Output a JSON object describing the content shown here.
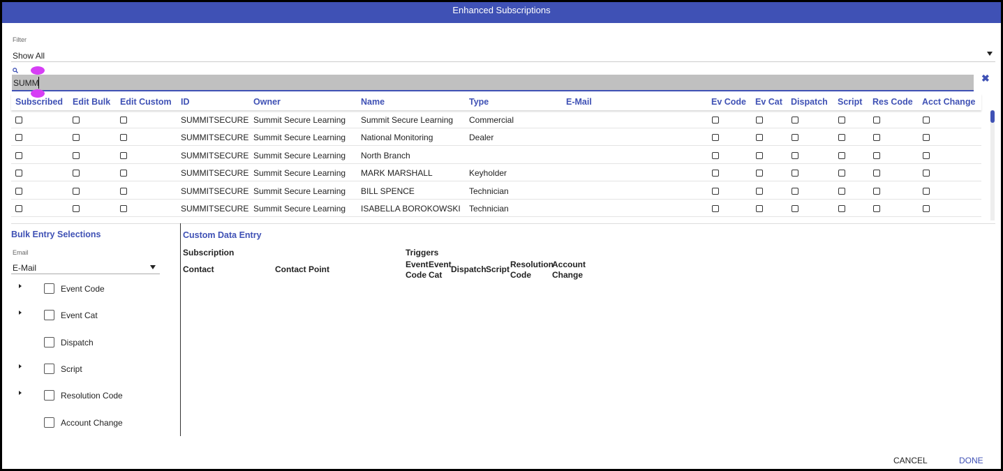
{
  "title": "Enhanced Subscriptions",
  "filter": {
    "label": "Filter",
    "value": "Show All"
  },
  "search": {
    "value": "SUMM"
  },
  "table": {
    "columns": [
      "Subscribed",
      "Edit Bulk",
      "Edit Custom",
      "ID",
      "Owner",
      "Name",
      "Type",
      "E-Mail",
      "Ev Code",
      "Ev Cat",
      "Dispatch",
      "Script",
      "Res Code",
      "Acct Change"
    ],
    "rows": [
      {
        "id": "SUMMITSECURE",
        "owner": "Summit Secure Learning",
        "name": "Summit Secure Learning",
        "type": "Commercial",
        "email": ""
      },
      {
        "id": "SUMMITSECURE",
        "owner": "Summit Secure Learning",
        "name": "National Monitoring",
        "type": "Dealer",
        "email": ""
      },
      {
        "id": "SUMMITSECURE",
        "owner": "Summit Secure Learning",
        "name": "North Branch",
        "type": "",
        "email": ""
      },
      {
        "id": "SUMMITSECURE",
        "owner": "Summit Secure Learning",
        "name": "MARK MARSHALL",
        "type": "Keyholder",
        "email": ""
      },
      {
        "id": "SUMMITSECURE",
        "owner": "Summit Secure Learning",
        "name": "BILL SPENCE",
        "type": "Technician",
        "email": ""
      },
      {
        "id": "SUMMITSECURE",
        "owner": "Summit Secure Learning",
        "name": "ISABELLA BOROKOWSKI",
        "type": "Technician",
        "email": ""
      }
    ]
  },
  "bulk": {
    "title": "Bulk Entry Selections",
    "email_label": "Email",
    "email_value": "E-Mail",
    "items": [
      {
        "label": "Event Code",
        "expandable": true
      },
      {
        "label": "Event Cat",
        "expandable": true
      },
      {
        "label": "Dispatch",
        "expandable": false
      },
      {
        "label": "Script",
        "expandable": true
      },
      {
        "label": "Resolution Code",
        "expandable": true
      },
      {
        "label": "Account Change",
        "expandable": false
      }
    ]
  },
  "custom": {
    "title": "Custom Data Entry",
    "subscription": "Subscription",
    "triggers": "Triggers",
    "contact": "Contact",
    "contact_point": "Contact Point",
    "event_code": [
      "Event",
      "Code"
    ],
    "event_cat": [
      "Event",
      "Cat"
    ],
    "dispatch": "Dispatch",
    "script": "Script",
    "resolution_code": [
      "Resolution",
      "Code"
    ],
    "account_change": [
      "Account",
      "Change"
    ]
  },
  "footer": {
    "cancel": "CANCEL",
    "done": "DONE"
  },
  "colors": {
    "accent": "#3f51b5",
    "search_bg": "#c0c0c0"
  }
}
